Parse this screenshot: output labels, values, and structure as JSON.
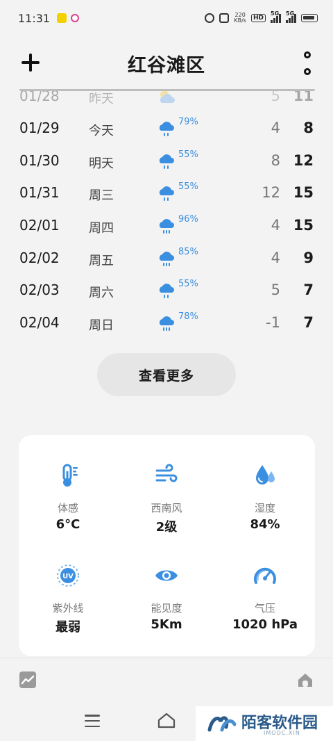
{
  "status_bar": {
    "time": "11:31",
    "net_speed_value": "220",
    "net_speed_unit": "KB/s",
    "hd_label": "HD",
    "sim1_label": "5G",
    "sim2_label": "5G"
  },
  "header": {
    "title": "红谷滩区",
    "add_icon": "plus-icon",
    "more_icon": "vertical-dots-icon"
  },
  "forecast": [
    {
      "date": "01/28",
      "name": "昨天",
      "icon": "partly-cloudy",
      "pct": "",
      "low": "5",
      "high": "11"
    },
    {
      "date": "01/29",
      "name": "今天",
      "icon": "rain",
      "pct": "79%",
      "low": "4",
      "high": "8"
    },
    {
      "date": "01/30",
      "name": "明天",
      "icon": "rain",
      "pct": "55%",
      "low": "8",
      "high": "12"
    },
    {
      "date": "01/31",
      "name": "周三",
      "icon": "rain",
      "pct": "55%",
      "low": "12",
      "high": "15"
    },
    {
      "date": "02/01",
      "name": "周四",
      "icon": "rain",
      "pct": "96%",
      "low": "4",
      "high": "15"
    },
    {
      "date": "02/02",
      "name": "周五",
      "icon": "rain",
      "pct": "85%",
      "low": "4",
      "high": "9"
    },
    {
      "date": "02/03",
      "name": "周六",
      "icon": "rain",
      "pct": "55%",
      "low": "5",
      "high": "7"
    },
    {
      "date": "02/04",
      "name": "周日",
      "icon": "rain",
      "pct": "78%",
      "low": "-1",
      "high": "7"
    }
  ],
  "see_more_label": "查看更多",
  "details": [
    {
      "label": "体感",
      "value": "6°C",
      "icon": "thermometer-icon"
    },
    {
      "label": "西南风",
      "value": "2级",
      "icon": "wind-icon"
    },
    {
      "label": "湿度",
      "value": "84%",
      "icon": "humidity-icon"
    },
    {
      "label": "紫外线",
      "value": "最弱",
      "icon": "uv-icon"
    },
    {
      "label": "能见度",
      "value": "5Km",
      "icon": "eye-icon"
    },
    {
      "label": "气压",
      "value": "1020 hPa",
      "icon": "gauge-icon"
    }
  ],
  "watermark": {
    "title": "陌客软件园",
    "sub": "IMOOC.XIN"
  },
  "colors": {
    "accent": "#3b8fe0",
    "background": "#f3f3f3",
    "card": "#ffffff"
  }
}
